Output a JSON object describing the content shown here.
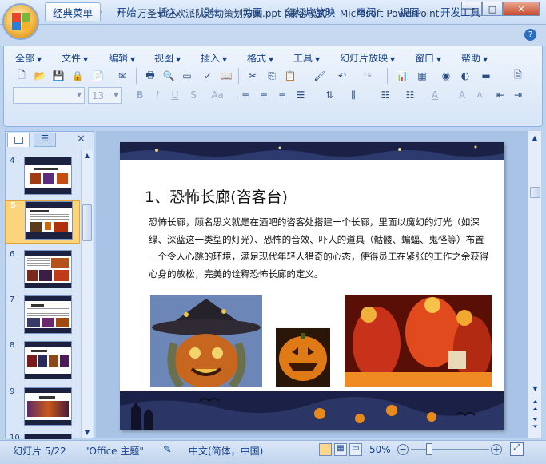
{
  "window": {
    "title": "万圣节狂欢派队活动策划方案.ppt [兼容模式] - Microsoft PowerPoint",
    "min": "─",
    "max": "□",
    "close": "✕"
  },
  "tabs": [
    "经典菜单",
    "开始",
    "插入",
    "设计",
    "动画",
    "幻灯片放映",
    "审阅",
    "视图",
    "开发工具"
  ],
  "menus": [
    "全部",
    "文件",
    "编辑",
    "视图",
    "插入",
    "格式",
    "工具",
    "幻灯片放映",
    "窗口",
    "帮助"
  ],
  "font": {
    "name": "",
    "size": "13"
  },
  "slides": [
    {
      "num": "4"
    },
    {
      "num": "5"
    },
    {
      "num": "6"
    },
    {
      "num": "7"
    },
    {
      "num": "8"
    },
    {
      "num": "9"
    },
    {
      "num": "10"
    }
  ],
  "slide": {
    "title": "1、恐怖长廊(咨客台)",
    "body": "恐怖长廊，顾名思义就是在酒吧的咨客处搭建一个长廊，里面以魔幻的灯光（如深绿、深蓝这一类型的灯光）、恐怖的音效、吓人的道具（骷髅、蝙蝠、鬼怪等）布置一个令人心跳的环境，满足现代年轻人猎奇的心态，使得员工在紧张的工作之余获得心身的放松，完美的诠释恐怖长廊的定义。"
  },
  "status": {
    "slide_info": "幻灯片 5/22",
    "theme": "\"Office 主题\"",
    "language": "中文(简体，中国)",
    "zoom": "50%"
  },
  "colors": {
    "selected_thumb": "#fbd47c",
    "ribbon": "#d7e5f7",
    "slide_bg": "#ffffff"
  }
}
